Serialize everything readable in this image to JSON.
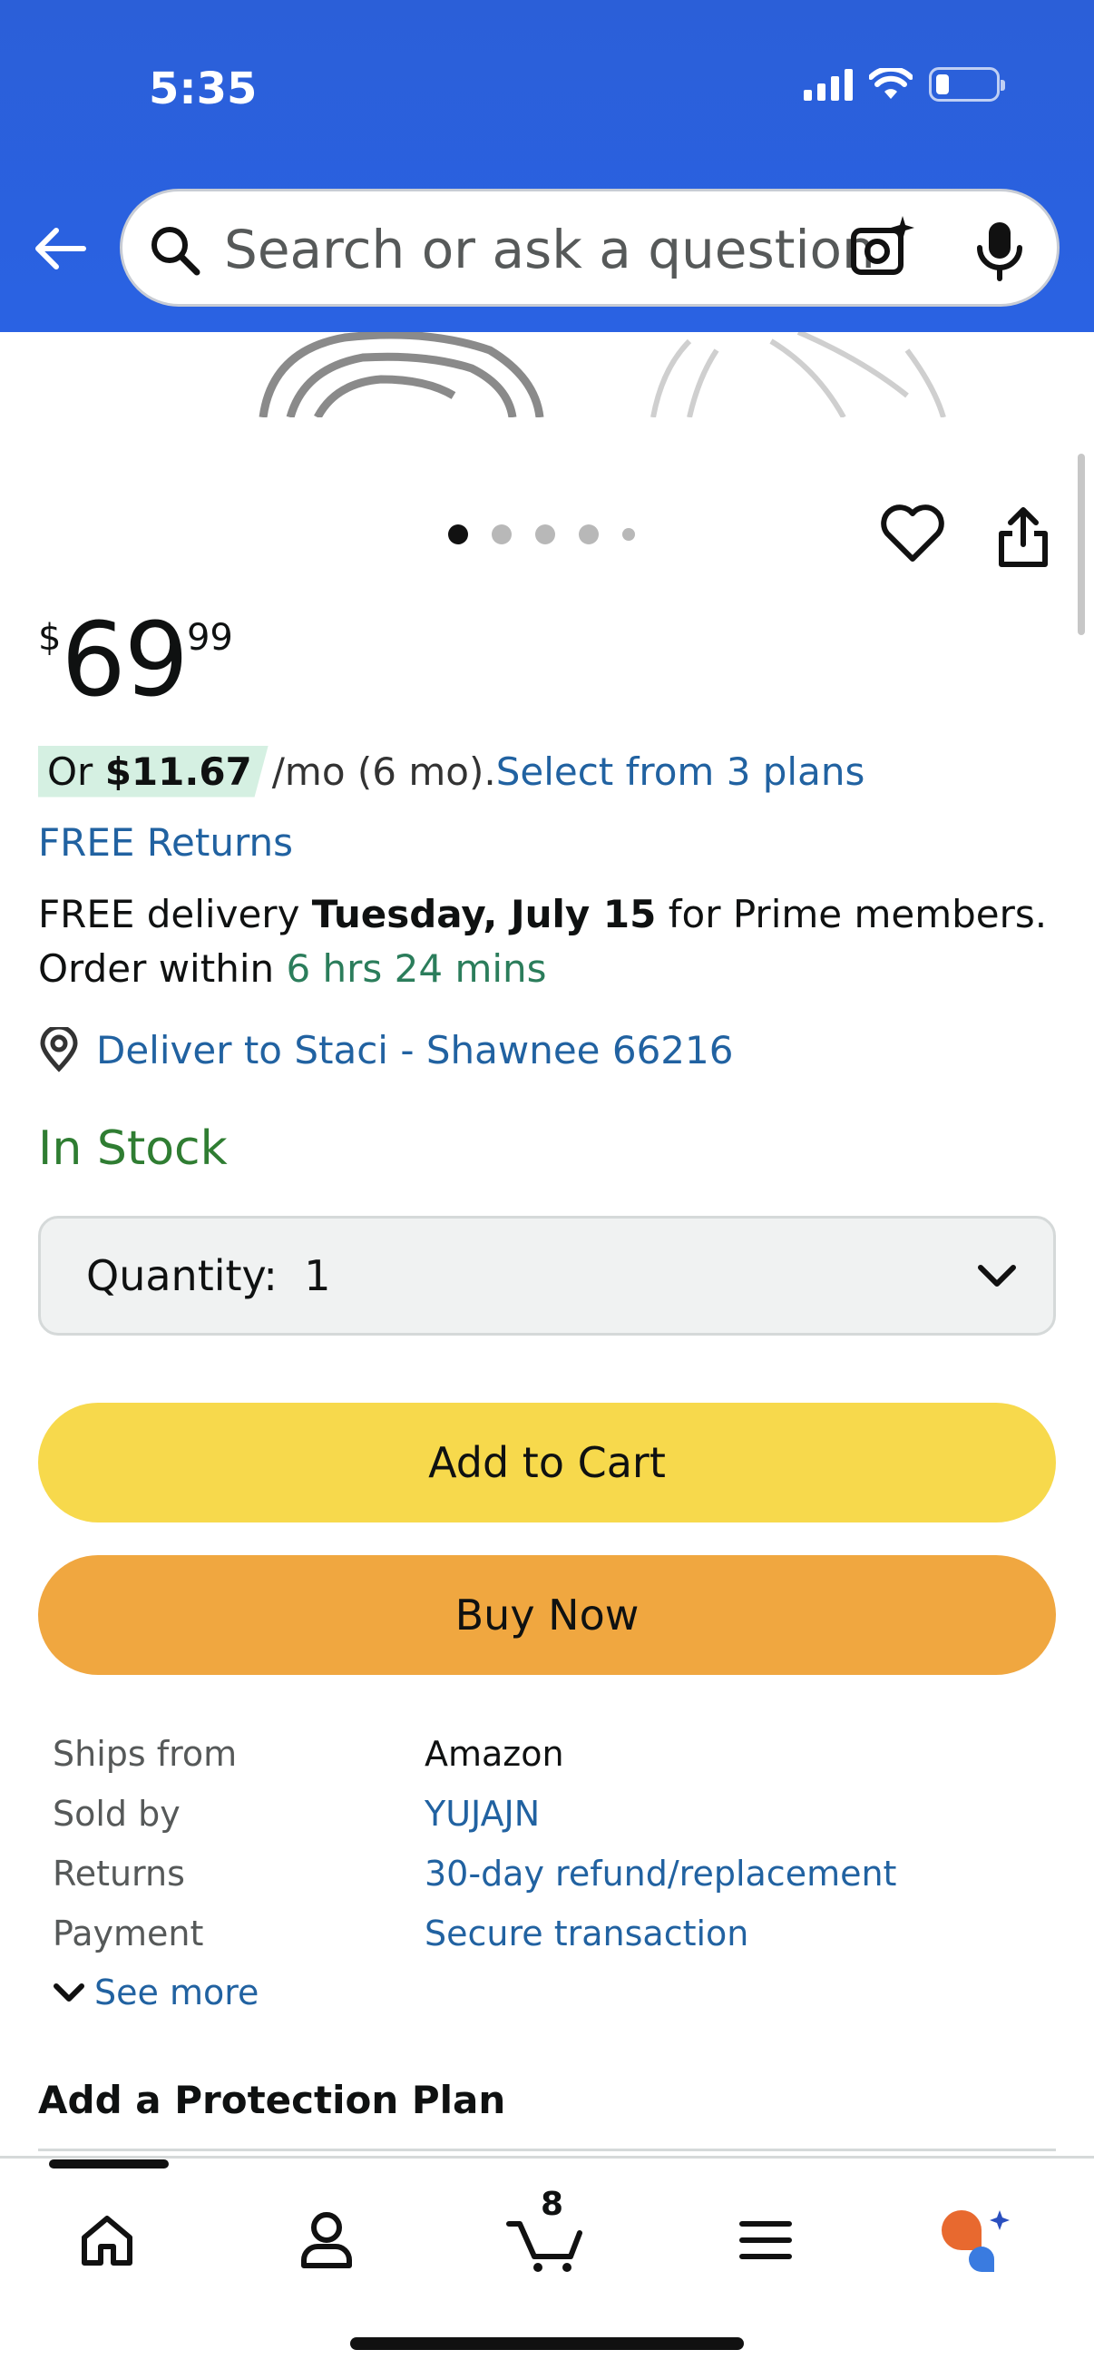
{
  "status_bar": {
    "time": "5:35"
  },
  "search": {
    "placeholder": "Search or ask a question"
  },
  "icons": {
    "back": "back-arrow-icon",
    "search": "search-icon",
    "camera": "camera-sparkle-icon",
    "mic": "microphone-icon",
    "heart": "heart-icon",
    "share": "share-icon",
    "location": "location-pin-icon",
    "chevron": "chevron-down-icon"
  },
  "carousel": {
    "count": 5,
    "active_index": 0
  },
  "price": {
    "symbol": "$",
    "whole": "69",
    "fraction": "99"
  },
  "installment": {
    "prefix": "Or ",
    "amount": "$11.67",
    "suffix": " /mo (6 mo). ",
    "link": "Select from 3 plans"
  },
  "free_returns": "FREE Returns",
  "delivery": {
    "prefix": "FREE delivery ",
    "date": "Tuesday, July 15",
    "suffix": " for Prime members.",
    "order_prefix": "Order within ",
    "countdown": "6 hrs 24 mins"
  },
  "deliver_to": "Deliver to Staci - Shawnee 66216",
  "stock_status": "In Stock",
  "quantity": {
    "label": "Quantity:",
    "value": "1"
  },
  "buttons": {
    "add_to_cart": "Add to Cart",
    "buy_now": "Buy Now"
  },
  "details": [
    {
      "key": "Ships from",
      "value": "Amazon",
      "link": false
    },
    {
      "key": "Sold by",
      "value": "YUJAJN",
      "link": true
    },
    {
      "key": "Returns",
      "value": "30-day refund/replacement",
      "link": true
    },
    {
      "key": "Payment",
      "value": "Secure transaction",
      "link": true
    }
  ],
  "see_more": "See more",
  "protection_heading": "Add a Protection Plan",
  "bottom_nav": {
    "items": [
      "home",
      "account",
      "cart",
      "menu",
      "rufus"
    ],
    "cart_count": "8"
  },
  "colors": {
    "header": "#2a62e3",
    "link": "#2162a1",
    "in_stock": "#2f7d32",
    "add_to_cart": "#f7d94c",
    "buy_now": "#f0a740"
  }
}
